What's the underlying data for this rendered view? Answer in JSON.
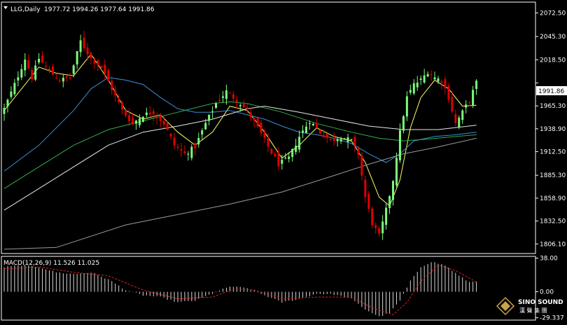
{
  "header": {
    "symbol": "LLG,Daily",
    "ohlc": "1977.72 1994.26 1977.64 1991.86"
  },
  "price_tag": "1991.86",
  "macd_header": "MACD(12,26,9) 11.526 11.025",
  "watermark": {
    "brand": "SINO SOUND",
    "brand_cn": "漢 聲 集 團"
  },
  "colors": {
    "background": "#000000",
    "bull": "#7CFC7C",
    "bear": "#E00000",
    "ma_yellow": "#FFFF66",
    "ma_blue": "#3A8FD8",
    "ma_green": "#2FAE4E",
    "ma_white": "#E8E8E8",
    "ma_gray": "#9A9A9A",
    "signal": "#E02020",
    "histogram": "#D8D8D8",
    "axis": "#FFFFFF"
  },
  "chart_data": [
    {
      "type": "candlestick",
      "title": "LLG,Daily",
      "ylim": [
        1795,
        2085
      ],
      "y_ticks": [
        "2072.50",
        "2045.30",
        "2018.50",
        "1991.86",
        "1965.30",
        "1938.90",
        "1912.50",
        "1885.30",
        "1858.90",
        "1832.50",
        "1806.10"
      ],
      "anchors": [
        {
          "i": 0,
          "c": 1962
        },
        {
          "i": 3,
          "c": 1990
        },
        {
          "i": 6,
          "c": 2020
        },
        {
          "i": 8,
          "c": 1998
        },
        {
          "i": 10,
          "c": 2020
        },
        {
          "i": 13,
          "c": 2005
        },
        {
          "i": 16,
          "c": 1995
        },
        {
          "i": 19,
          "c": 1998
        },
        {
          "i": 22,
          "c": 2040
        },
        {
          "i": 25,
          "c": 2020
        },
        {
          "i": 28,
          "c": 2010
        },
        {
          "i": 31,
          "c": 1985
        },
        {
          "i": 34,
          "c": 1960
        },
        {
          "i": 37,
          "c": 1945
        },
        {
          "i": 40,
          "c": 1955
        },
        {
          "i": 43,
          "c": 1958
        },
        {
          "i": 46,
          "c": 1945
        },
        {
          "i": 49,
          "c": 1920
        },
        {
          "i": 52,
          "c": 1910
        },
        {
          "i": 55,
          "c": 1918
        },
        {
          "i": 58,
          "c": 1945
        },
        {
          "i": 61,
          "c": 1968
        },
        {
          "i": 64,
          "c": 1982
        },
        {
          "i": 67,
          "c": 1972
        },
        {
          "i": 70,
          "c": 1960
        },
        {
          "i": 73,
          "c": 1940
        },
        {
          "i": 76,
          "c": 1918
        },
        {
          "i": 79,
          "c": 1898
        },
        {
          "i": 82,
          "c": 1905
        },
        {
          "i": 85,
          "c": 1930
        },
        {
          "i": 88,
          "c": 1948
        },
        {
          "i": 91,
          "c": 1935
        },
        {
          "i": 94,
          "c": 1925
        },
        {
          "i": 97,
          "c": 1930
        },
        {
          "i": 100,
          "c": 1925
        },
        {
          "i": 102,
          "c": 1910
        },
        {
          "i": 104,
          "c": 1860
        },
        {
          "i": 106,
          "c": 1830
        },
        {
          "i": 108,
          "c": 1815
        },
        {
          "i": 110,
          "c": 1845
        },
        {
          "i": 112,
          "c": 1880
        },
        {
          "i": 114,
          "c": 1935
        },
        {
          "i": 116,
          "c": 1975
        },
        {
          "i": 118,
          "c": 1990
        },
        {
          "i": 120,
          "c": 1995
        },
        {
          "i": 122,
          "c": 2005
        },
        {
          "i": 124,
          "c": 1998
        },
        {
          "i": 126,
          "c": 1995
        },
        {
          "i": 128,
          "c": 1975
        },
        {
          "i": 130,
          "c": 1945
        },
        {
          "i": 132,
          "c": 1958
        },
        {
          "i": 134,
          "c": 1972
        },
        {
          "i": 136,
          "c": 1992
        }
      ],
      "ma_ma": [
        {
          "name": "",
          "color": "#FFFF66",
          "points": [
            [
              0,
              1960
            ],
            [
              5,
              1985
            ],
            [
              10,
              2010
            ],
            [
              15,
              2003
            ],
            [
              20,
              2000
            ],
            [
              25,
              2025
            ],
            [
              30,
              1995
            ],
            [
              35,
              1960
            ],
            [
              40,
              1950
            ],
            [
              45,
              1955
            ],
            [
              50,
              1935
            ],
            [
              55,
              1920
            ],
            [
              60,
              1935
            ],
            [
              65,
              1965
            ],
            [
              70,
              1960
            ],
            [
              75,
              1935
            ],
            [
              80,
              1905
            ],
            [
              85,
              1920
            ],
            [
              90,
              1940
            ],
            [
              95,
              1930
            ],
            [
              100,
              1925
            ],
            [
              104,
              1900
            ],
            [
              108,
              1860
            ],
            [
              111,
              1850
            ],
            [
              114,
              1880
            ],
            [
              117,
              1940
            ],
            [
              120,
              1975
            ],
            [
              124,
              1995
            ],
            [
              128,
              1985
            ],
            [
              132,
              1965
            ],
            [
              136,
              1966
            ]
          ]
        },
        {
          "name": "",
          "color": "#3A8FD8",
          "points": [
            [
              0,
              1890
            ],
            [
              10,
              1920
            ],
            [
              20,
              1960
            ],
            [
              25,
              1985
            ],
            [
              30,
              1998
            ],
            [
              35,
              1995
            ],
            [
              40,
              1990
            ],
            [
              45,
              1975
            ],
            [
              50,
              1962
            ],
            [
              55,
              1958
            ],
            [
              60,
              1958
            ],
            [
              65,
              1960
            ],
            [
              70,
              1955
            ],
            [
              75,
              1950
            ],
            [
              80,
              1942
            ],
            [
              85,
              1935
            ],
            [
              90,
              1932
            ],
            [
              95,
              1928
            ],
            [
              100,
              1922
            ],
            [
              105,
              1910
            ],
            [
              110,
              1900
            ],
            [
              114,
              1910
            ],
            [
              118,
              1925
            ],
            [
              124,
              1930
            ],
            [
              130,
              1932
            ],
            [
              136,
              1935
            ]
          ]
        },
        {
          "name": "",
          "color": "#2FAE4E",
          "points": [
            [
              0,
              1870
            ],
            [
              10,
              1895
            ],
            [
              20,
              1920
            ],
            [
              30,
              1938
            ],
            [
              40,
              1948
            ],
            [
              50,
              1958
            ],
            [
              60,
              1968
            ],
            [
              65,
              1970
            ],
            [
              70,
              1968
            ],
            [
              80,
              1958
            ],
            [
              90,
              1945
            ],
            [
              100,
              1935
            ],
            [
              108,
              1928
            ],
            [
              115,
              1925
            ],
            [
              122,
              1927
            ],
            [
              130,
              1930
            ],
            [
              136,
              1932
            ]
          ]
        },
        {
          "name": "",
          "color": "#E8E8E8",
          "points": [
            [
              0,
              1845
            ],
            [
              10,
              1870
            ],
            [
              20,
              1895
            ],
            [
              30,
              1920
            ],
            [
              40,
              1935
            ],
            [
              50,
              1942
            ],
            [
              60,
              1950
            ],
            [
              70,
              1962
            ],
            [
              75,
              1965
            ],
            [
              85,
              1958
            ],
            [
              95,
              1950
            ],
            [
              105,
              1942
            ],
            [
              115,
              1938
            ],
            [
              125,
              1938
            ],
            [
              136,
              1943
            ]
          ]
        },
        {
          "name": "",
          "color": "#9A9A9A",
          "points": [
            [
              0,
              1800
            ],
            [
              15,
              1802
            ],
            [
              25,
              1815
            ],
            [
              35,
              1828
            ],
            [
              50,
              1840
            ],
            [
              65,
              1852
            ],
            [
              80,
              1866
            ],
            [
              95,
              1885
            ],
            [
              105,
              1898
            ],
            [
              115,
              1910
            ],
            [
              125,
              1918
            ],
            [
              136,
              1928
            ]
          ]
        }
      ]
    },
    {
      "type": "bar",
      "title": "MACD(12,26,9) 11.526 11.025",
      "ylim": [
        -32,
        40
      ],
      "y_ticks": [
        "38.00",
        "0.00",
        "-29.337"
      ],
      "macd_anchors": [
        {
          "i": 0,
          "v": 28
        },
        {
          "i": 5,
          "v": 30
        },
        {
          "i": 10,
          "v": 28
        },
        {
          "i": 15,
          "v": 22
        },
        {
          "i": 20,
          "v": 20
        },
        {
          "i": 25,
          "v": 22
        },
        {
          "i": 30,
          "v": 14
        },
        {
          "i": 35,
          "v": 2
        },
        {
          "i": 40,
          "v": -4
        },
        {
          "i": 45,
          "v": -6
        },
        {
          "i": 50,
          "v": -12
        },
        {
          "i": 55,
          "v": -10
        },
        {
          "i": 60,
          "v": -2
        },
        {
          "i": 65,
          "v": 6
        },
        {
          "i": 70,
          "v": 4
        },
        {
          "i": 75,
          "v": -4
        },
        {
          "i": 80,
          "v": -12
        },
        {
          "i": 85,
          "v": -8
        },
        {
          "i": 90,
          "v": -2
        },
        {
          "i": 95,
          "v": -3
        },
        {
          "i": 100,
          "v": -8
        },
        {
          "i": 104,
          "v": -20
        },
        {
          "i": 108,
          "v": -28
        },
        {
          "i": 111,
          "v": -24
        },
        {
          "i": 114,
          "v": -10
        },
        {
          "i": 117,
          "v": 12
        },
        {
          "i": 120,
          "v": 28
        },
        {
          "i": 123,
          "v": 34
        },
        {
          "i": 127,
          "v": 30
        },
        {
          "i": 131,
          "v": 18
        },
        {
          "i": 134,
          "v": 11
        },
        {
          "i": 136,
          "v": 12
        }
      ],
      "signal_anchors": [
        {
          "i": 0,
          "v": 26
        },
        {
          "i": 10,
          "v": 28
        },
        {
          "i": 20,
          "v": 22
        },
        {
          "i": 30,
          "v": 18
        },
        {
          "i": 40,
          "v": 2
        },
        {
          "i": 50,
          "v": -8
        },
        {
          "i": 60,
          "v": -6
        },
        {
          "i": 66,
          "v": 3
        },
        {
          "i": 72,
          "v": 2
        },
        {
          "i": 80,
          "v": -8
        },
        {
          "i": 90,
          "v": -6
        },
        {
          "i": 100,
          "v": -6
        },
        {
          "i": 106,
          "v": -18
        },
        {
          "i": 112,
          "v": -26
        },
        {
          "i": 116,
          "v": -12
        },
        {
          "i": 120,
          "v": 12
        },
        {
          "i": 125,
          "v": 30
        },
        {
          "i": 130,
          "v": 24
        },
        {
          "i": 136,
          "v": 11
        }
      ]
    }
  ]
}
